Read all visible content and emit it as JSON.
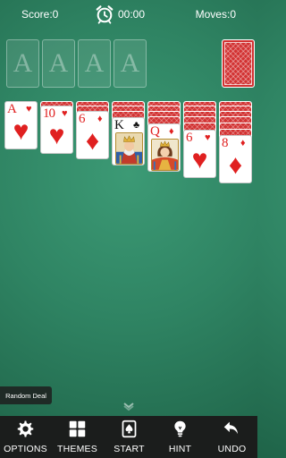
{
  "status": {
    "score": "Score:0",
    "timer": "00:00",
    "moves": "Moves:0"
  },
  "foundations": [
    "A",
    "A",
    "A",
    "A"
  ],
  "tableau": [
    {
      "rank": "A",
      "suit": "♥"
    },
    {
      "rank": "10",
      "suit": "♥"
    },
    {
      "rank": "6",
      "suit": "♦"
    },
    {
      "rank": "K",
      "suit": "♣"
    },
    {
      "rank": "Q",
      "suit": "♦"
    },
    {
      "rank": "6",
      "suit": "♥"
    },
    {
      "rank": "8",
      "suit": "♦"
    }
  ],
  "random_deal": "Random Deal",
  "toolbar": {
    "options": "OPTIONS",
    "themes": "THEMES",
    "start": "START",
    "hint": "HINT",
    "undo": "UNDO"
  }
}
